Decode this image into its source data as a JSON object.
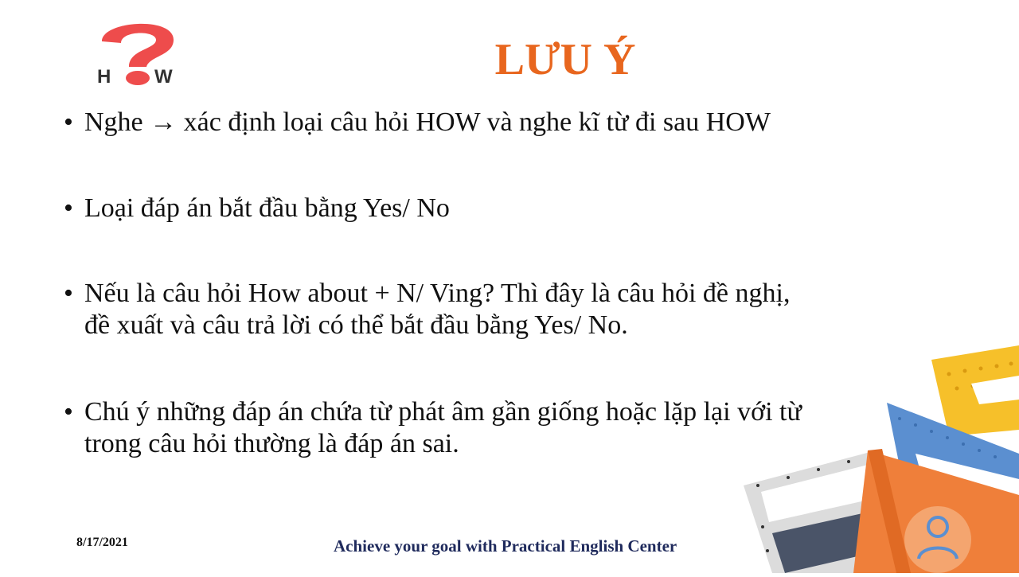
{
  "logo": {
    "icon": "question-how-icon",
    "text": "H  W",
    "color": "#ee4c4c"
  },
  "title": "LƯU Ý",
  "bullets": [
    {
      "marker": "•",
      "lines": [
        "Nghe → xác định loại câu hỏi HOW và nghe kĩ từ đi sau HOW"
      ]
    },
    {
      "marker": "•",
      "lines": [
        "Loại đáp án bắt đầu bằng Yes/ No"
      ]
    },
    {
      "marker": "•",
      "lines": [
        "Nếu là câu hỏi How about + N/ Ving?  Thì đây là câu hỏi đề nghị,",
        "đề xuất và câu trả lời có thể bắt đầu bằng Yes/ No."
      ]
    },
    {
      "marker": "•",
      "lines": [
        "Chú ý những đáp án chứa từ phát âm gần giống hoặc lặp lại với từ",
        "trong câu hỏi thường là đáp án sai."
      ]
    }
  ],
  "footer": {
    "date": "8/17/2021",
    "tagline": "Achieve your goal with Practical English Center"
  },
  "colors": {
    "title": "#e8661e",
    "tagline": "#1f2a5c",
    "deco_orange": "#ef7f3a",
    "deco_blue": "#5b8fd0",
    "deco_yellow": "#f6c02a"
  }
}
